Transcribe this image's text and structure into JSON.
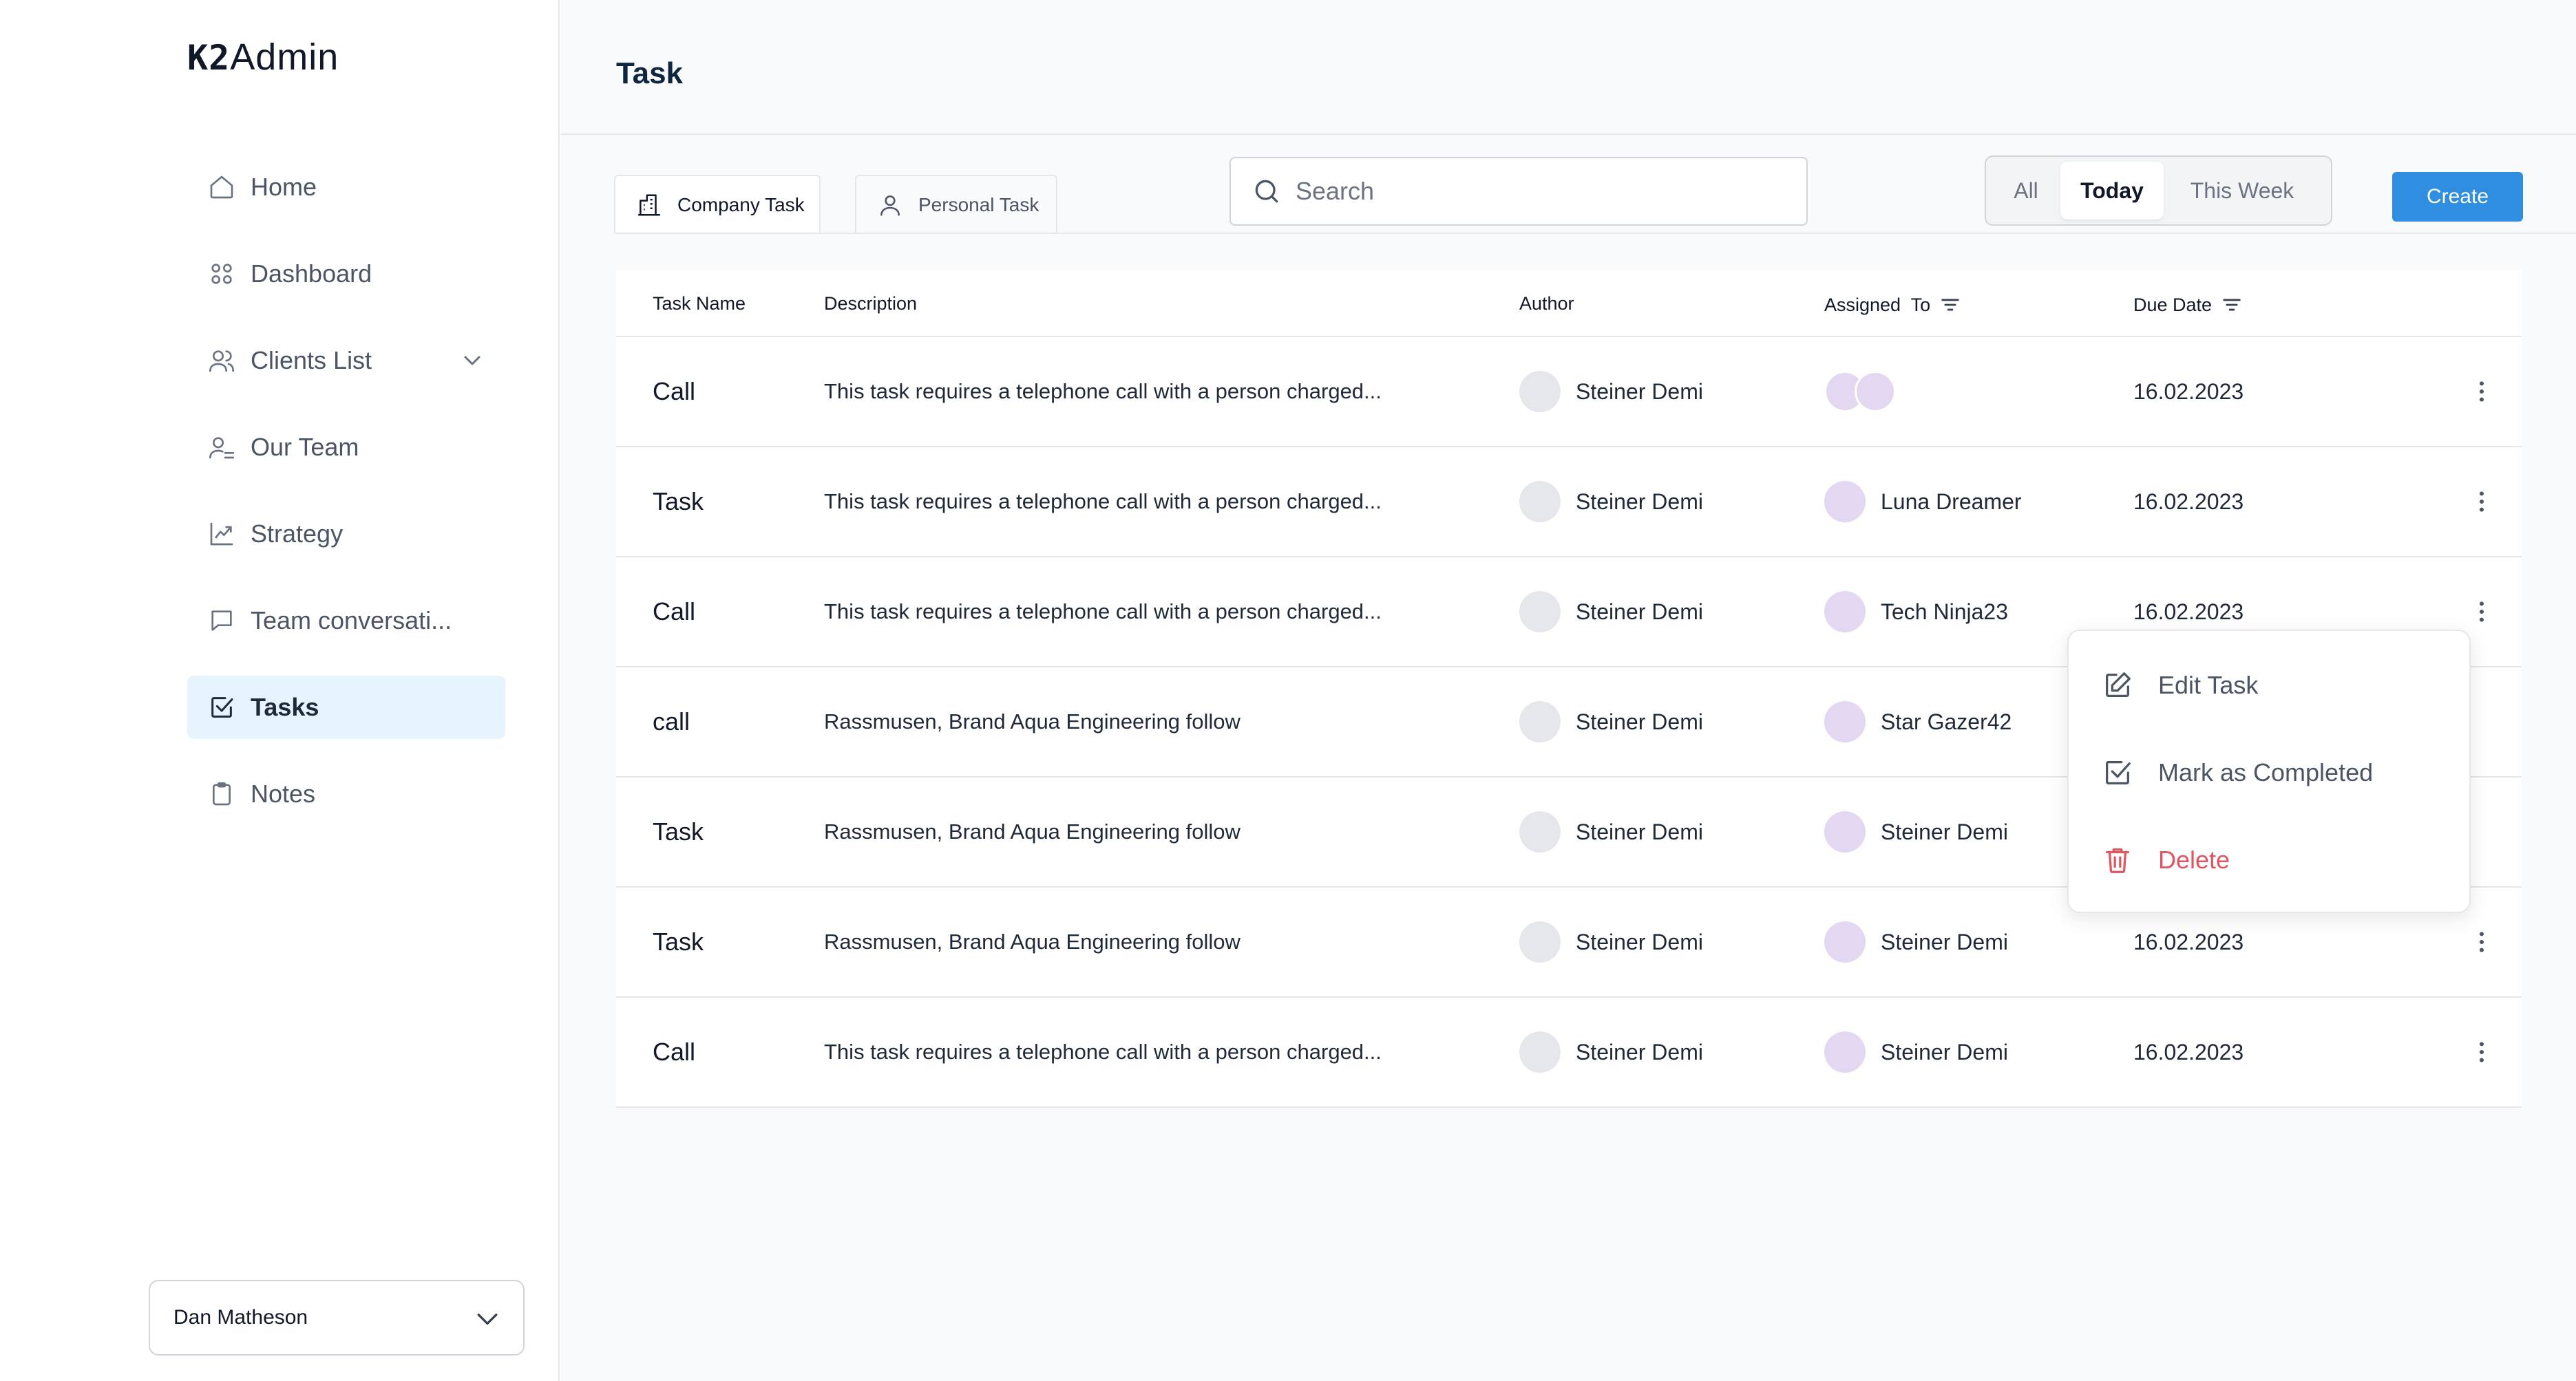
{
  "app": {
    "logo_prefix": "K2",
    "logo_suffix": "Admin"
  },
  "sidebar": {
    "items": [
      {
        "label": "Home",
        "icon": "home-icon"
      },
      {
        "label": "Dashboard",
        "icon": "dashboard-icon"
      },
      {
        "label": "Clients List",
        "icon": "users-icon",
        "has_submenu": true
      },
      {
        "label": "Our Team",
        "icon": "user-list-icon"
      },
      {
        "label": "Strategy",
        "icon": "chart-line-icon"
      },
      {
        "label": "Team conversati...",
        "icon": "chat-icon"
      },
      {
        "label": "Tasks",
        "icon": "checkbox-icon",
        "active": true
      },
      {
        "label": "Notes",
        "icon": "clipboard-icon"
      }
    ],
    "user": {
      "name": "Dan Matheson"
    }
  },
  "header": {
    "title": "Task"
  },
  "tabs": [
    {
      "label": "Company Task",
      "icon": "building-icon",
      "active": true
    },
    {
      "label": "Personal Task",
      "icon": "person-icon",
      "active": false
    }
  ],
  "search": {
    "placeholder": "Search",
    "value": ""
  },
  "filters": [
    {
      "label": "All",
      "active": false
    },
    {
      "label": "Today",
      "active": true
    },
    {
      "label": "This Week",
      "active": false
    }
  ],
  "create_label": "Create",
  "table": {
    "columns": {
      "name": "Task Name",
      "description": "Description",
      "author": "Author",
      "assigned": "Assigned  To",
      "due": "Due Date"
    },
    "rows": [
      {
        "name": "Call",
        "description": "This task requires a telephone call with a person charged...",
        "author": "Steiner Demi",
        "assigned": "",
        "assigned_multi": true,
        "due": "16.02.2023"
      },
      {
        "name": "Task",
        "description": "This task requires a telephone call with a person charged...",
        "author": "Steiner Demi",
        "assigned": "Luna Dreamer",
        "due": "16.02.2023"
      },
      {
        "name": "Call",
        "description": "This task requires a telephone call with a person charged...",
        "author": "Steiner Demi",
        "assigned": "Tech Ninja23",
        "due": "16.02.2023"
      },
      {
        "name": "call",
        "description": "Rassmusen, Brand Aqua Engineering follow",
        "author": "Steiner Demi",
        "assigned": "Star Gazer42",
        "due": ""
      },
      {
        "name": "Task",
        "description": "Rassmusen, Brand Aqua Engineering follow",
        "author": "Steiner Demi",
        "assigned": "Steiner Demi",
        "due": ""
      },
      {
        "name": "Task",
        "description": "Rassmusen, Brand Aqua Engineering follow",
        "author": "Steiner Demi",
        "assigned": "Steiner Demi",
        "due": "16.02.2023"
      },
      {
        "name": "Call",
        "description": "This task requires a telephone call with a person charged...",
        "author": "Steiner Demi",
        "assigned": "Steiner Demi",
        "due": "16.02.2023"
      }
    ]
  },
  "context_menu": {
    "edit": "Edit Task",
    "complete": "Mark as Completed",
    "delete": "Delete"
  },
  "colors": {
    "accent": "#2f8ee0",
    "active_nav_bg": "#e6f5fd",
    "danger": "#e0555f"
  }
}
